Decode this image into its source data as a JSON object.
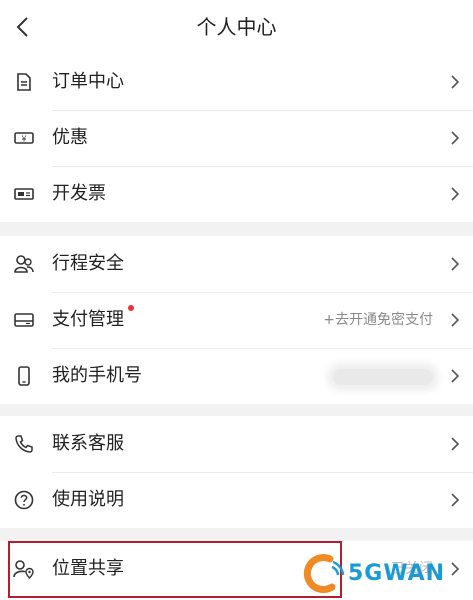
{
  "header": {
    "title": "个人中心",
    "back_icon": "chevron-left-icon"
  },
  "groups": [
    {
      "items": [
        {
          "label": "订单中心",
          "icon": "document-icon"
        },
        {
          "label": "优惠",
          "icon": "coupon-icon"
        },
        {
          "label": "开发票",
          "icon": "invoice-icon"
        }
      ]
    },
    {
      "items": [
        {
          "label": "行程安全",
          "icon": "people-icon"
        },
        {
          "label": "支付管理",
          "icon": "card-icon",
          "value": "+去开通免密支付",
          "has_dot": true
        },
        {
          "label": "我的手机号",
          "icon": "phone-icon"
        }
      ]
    },
    {
      "items": [
        {
          "label": "联系客服",
          "icon": "phone-call-icon"
        },
        {
          "label": "使用说明",
          "icon": "question-icon"
        }
      ]
    },
    {
      "items": [
        {
          "label": "位置共享",
          "icon": "person-location-icon",
          "value": "已关闭"
        }
      ]
    }
  ],
  "watermark": {
    "text": "5GWAN"
  },
  "colors": {
    "accent": "#e8333a",
    "highlight": "#b01e2f",
    "watermark": "#1a9bd7"
  }
}
